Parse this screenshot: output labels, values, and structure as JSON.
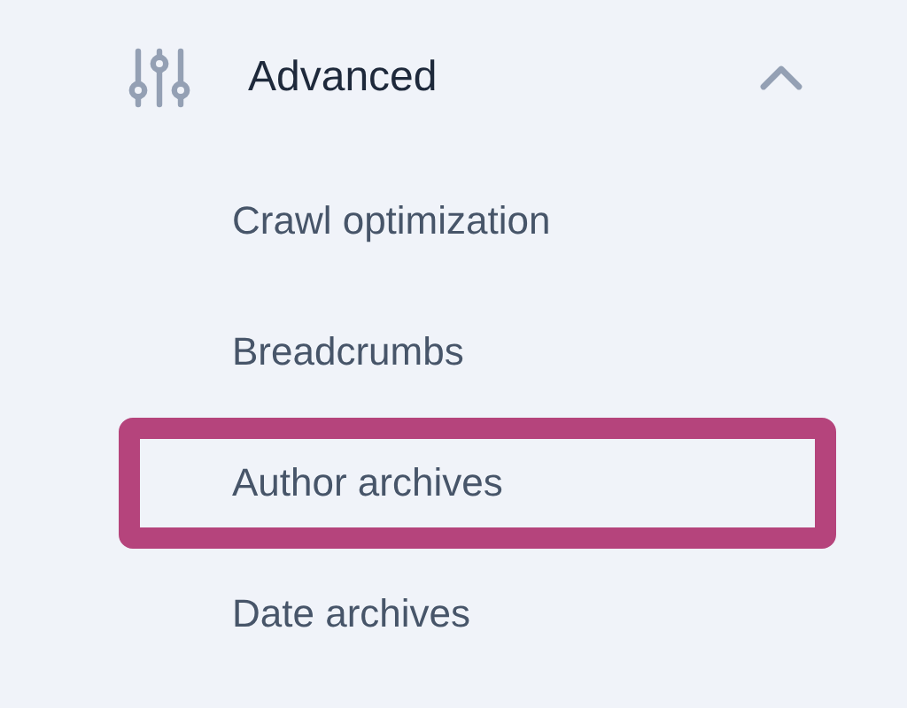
{
  "section": {
    "title": "Advanced",
    "expanded": true,
    "items": [
      {
        "label": "Crawl optimization",
        "highlighted": false
      },
      {
        "label": "Breadcrumbs",
        "highlighted": false
      },
      {
        "label": "Author archives",
        "highlighted": true
      },
      {
        "label": "Date archives",
        "highlighted": false
      }
    ]
  }
}
